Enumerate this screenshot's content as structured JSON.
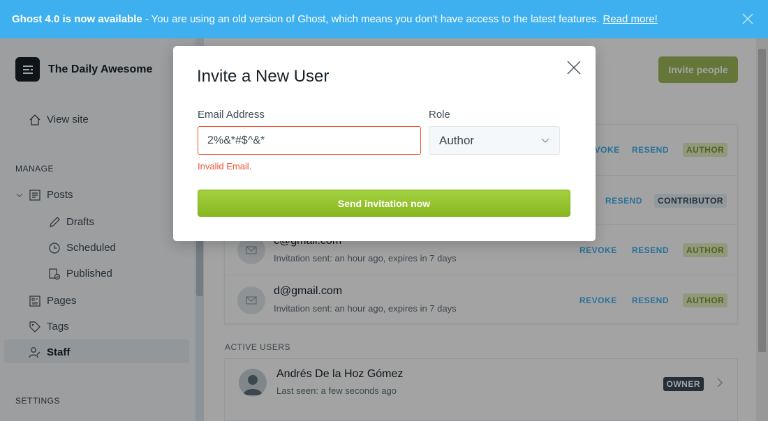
{
  "banner": {
    "bold": "Ghost 4.0 is now available",
    "message": " - You are using an old version of Ghost, which means you don't have access to the latest features.",
    "link": "Read more!"
  },
  "sidebar": {
    "site_name": "The Daily Awesome",
    "view_site": "View site",
    "manage_label": "MANAGE",
    "posts": "Posts",
    "drafts": "Drafts",
    "scheduled": "Scheduled",
    "published": "Published",
    "pages": "Pages",
    "tags": "Tags",
    "staff": "Staff",
    "settings_label": "SETTINGS"
  },
  "main": {
    "invite_button": "Invite people",
    "invites": [
      {
        "email": "",
        "meta": "",
        "revoke": "REVOKE",
        "resend": "RESEND",
        "role": "AUTHOR"
      },
      {
        "email": "",
        "meta": "",
        "revoke": "",
        "resend": "RESEND",
        "role": "CONTRIBUTOR"
      },
      {
        "email": "c@gmail.com",
        "meta": "Invitation sent: an hour ago, expires in 7 days",
        "revoke": "REVOKE",
        "resend": "RESEND",
        "role": "AUTHOR"
      },
      {
        "email": "d@gmail.com",
        "meta": "Invitation sent: an hour ago, expires in 7 days",
        "revoke": "REVOKE",
        "resend": "RESEND",
        "role": "AUTHOR"
      }
    ],
    "active_users_label": "ACTIVE USERS",
    "active_users": [
      {
        "name": "Andrés De la Hoz Gómez",
        "seen": "Last seen: a few seconds ago",
        "role": "OWNER"
      }
    ]
  },
  "modal": {
    "title": "Invite a New User",
    "email_label": "Email Address",
    "email_value": "2%&*#$^&*",
    "role_label": "Role",
    "role_value": "Author",
    "error": "Invalid Email.",
    "send_button": "Send invitation now"
  }
}
